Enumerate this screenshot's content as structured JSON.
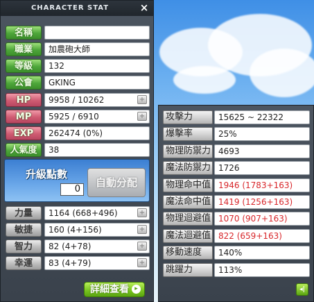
{
  "window": {
    "title": "CHARACTER STAT",
    "close_icon": "×"
  },
  "info_rows": [
    {
      "label": "名稱",
      "value": "",
      "style": "green"
    },
    {
      "label": "職業",
      "value": "加農砲大師",
      "style": "green"
    },
    {
      "label": "等級",
      "value": "132",
      "style": "green"
    },
    {
      "label": "公會",
      "value": "GKING",
      "style": "green"
    },
    {
      "label": "HP",
      "value": "9958 / 10262",
      "style": "pink",
      "plus": true
    },
    {
      "label": "MP",
      "value": "5925 / 6910",
      "style": "pink",
      "plus": true
    },
    {
      "label": "EXP",
      "value": "262474 (0%)",
      "style": "pink"
    },
    {
      "label": "人氣度",
      "value": "38",
      "style": "green"
    }
  ],
  "ability_points": {
    "title": "升級點數",
    "value": "0",
    "auto_button": "自動分配"
  },
  "stat_rows": [
    {
      "label": "力量",
      "value": "1164 (668+496)"
    },
    {
      "label": "敏捷",
      "value": "160 (4+156)"
    },
    {
      "label": "智力",
      "value": "82 (4+78)"
    },
    {
      "label": "幸運",
      "value": "83 (4+79)"
    }
  ],
  "stat_plus_symbol": "+",
  "detail_button": {
    "label": "詳細查看",
    "arrow": "▸"
  },
  "detail_rows": [
    {
      "label": "攻擊力",
      "value": "15625 ~ 22322",
      "red": false
    },
    {
      "label": "爆擊率",
      "value": "25%",
      "red": false
    },
    {
      "label": "物理防禦力",
      "value": "4693",
      "red": false
    },
    {
      "label": "魔法防禦力",
      "value": "1726",
      "red": false
    },
    {
      "label": "物理命中值",
      "value": "1946 (1783+163)",
      "red": true
    },
    {
      "label": "魔法命中值",
      "value": "1419 (1256+163)",
      "red": true
    },
    {
      "label": "物理迴避值",
      "value": "1070 (907+163)",
      "red": true
    },
    {
      "label": "魔法迴避值",
      "value": "822 (659+163)",
      "red": true
    },
    {
      "label": "移動速度",
      "value": "140%",
      "red": false
    },
    {
      "label": "跳躍力",
      "value": "113%",
      "red": false
    }
  ],
  "detail_close_button": "◂|",
  "colors": {
    "red_value": "#d8262a",
    "green_label": "#4ea73a",
    "pink_label": "#cf5b72",
    "window_bg": "#424a54"
  }
}
